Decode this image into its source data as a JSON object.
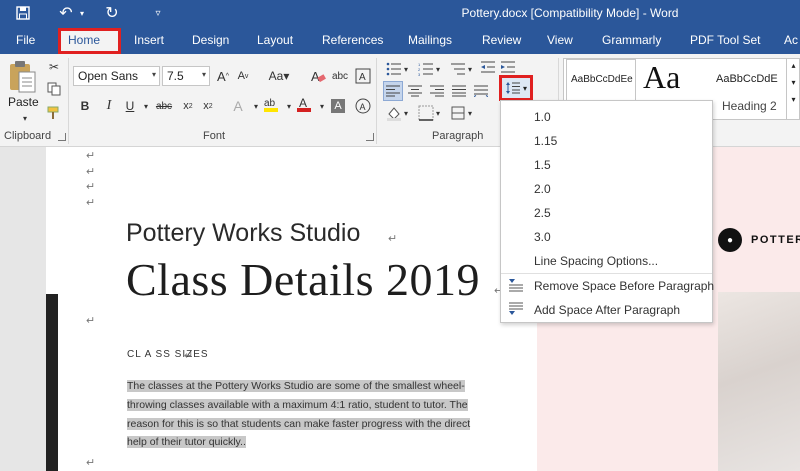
{
  "title_bar": {
    "title": "Pottery.docx [Compatibility Mode] - Word",
    "quick_access": [
      "save-icon",
      "undo-icon",
      "redo-icon",
      "customize-icon"
    ]
  },
  "tabs": [
    "File",
    "Home",
    "Insert",
    "Design",
    "Layout",
    "References",
    "Mailings",
    "Review",
    "View",
    "Grammarly",
    "PDF Tool Set",
    "Ac"
  ],
  "active_tab": "Home",
  "ribbon": {
    "clipboard": {
      "paste_label": "Paste",
      "group_label": "Clipboard"
    },
    "font": {
      "font_name": "Open Sans",
      "font_size": "7.5",
      "group_label": "Font"
    },
    "paragraph": {
      "group_label": "Paragraph"
    },
    "styles": {
      "items": [
        "AaBbCcDdEe",
        "Aa",
        "AaBbCcDdE"
      ],
      "heading_label": "Heading 2"
    }
  },
  "document": {
    "heading1": "Pottery Works Studio",
    "heading2": "Class Details 2019",
    "section_label": "CL A SS SIZES",
    "body_lines": [
      "The classes at the Pottery Works Studio are some of the smallest wheel-",
      "throwing classes available with a maximum 4:1 ratio, student to tutor. The",
      "reason for this is so that students can make faster progress with the direct",
      "help of their tutor quickly.."
    ],
    "side_logo_text": "POTTER"
  },
  "line_spacing_menu": {
    "options": [
      "1.0",
      "1.15",
      "1.5",
      "2.0",
      "2.5",
      "3.0"
    ],
    "line_spacing_options": "Line Spacing Options...",
    "remove_space_before": "Remove Space Before Paragraph",
    "add_space_after": "Add Space After Paragraph"
  },
  "colors": {
    "ribbon_blue": "#2b579a",
    "highlight_red": "#e02020",
    "selection_gray": "#c8c8c8"
  }
}
